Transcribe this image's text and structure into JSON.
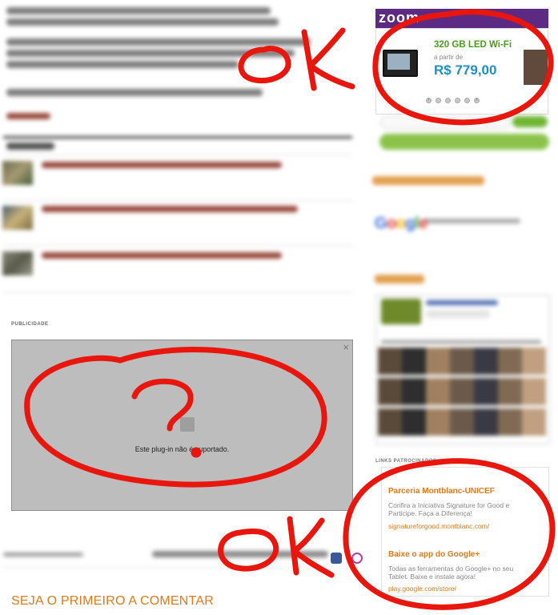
{
  "ad_area": {
    "label": "PUBLICIDADE",
    "plugin_message": "Este plug-in não é suportado.",
    "close_glyph": "×"
  },
  "comments": {
    "heading": "SEJA O PRIMEIRO A COMENTAR"
  },
  "sidebar": {
    "zoom_logo": "zoom",
    "product": {
      "name": "320 GB LED Wi-Fi",
      "price_prefix": "a partir de",
      "price": "R$ 779,00",
      "carousel_pages": 6,
      "carousel_active": 5
    },
    "google_word": "Google",
    "links_label": "LINKS PATROCINADOS",
    "ads": [
      {
        "title": "Parceria Montblanc-UNICEF",
        "description": "Confira a Iniciativa Signature for Good e Participe. Faça a Diferença!",
        "url": "signatureforgood.montblanc.com/"
      },
      {
        "title": "Baixe o app do Google+",
        "description": "Todas as ferramentas do Google+ no seu Tablet. Baixe e instale agora!",
        "url": "play.google.com/store/"
      }
    ]
  },
  "annotations": {
    "top_mark": "OK",
    "middle_mark": "?",
    "bottom_mark": "OK",
    "color": "#e8160c"
  },
  "colors": {
    "accent_orange": "#e07b1a",
    "price_blue": "#1d8fc4",
    "product_green": "#4a9d1c",
    "zoom_purple": "#5c2a83"
  }
}
